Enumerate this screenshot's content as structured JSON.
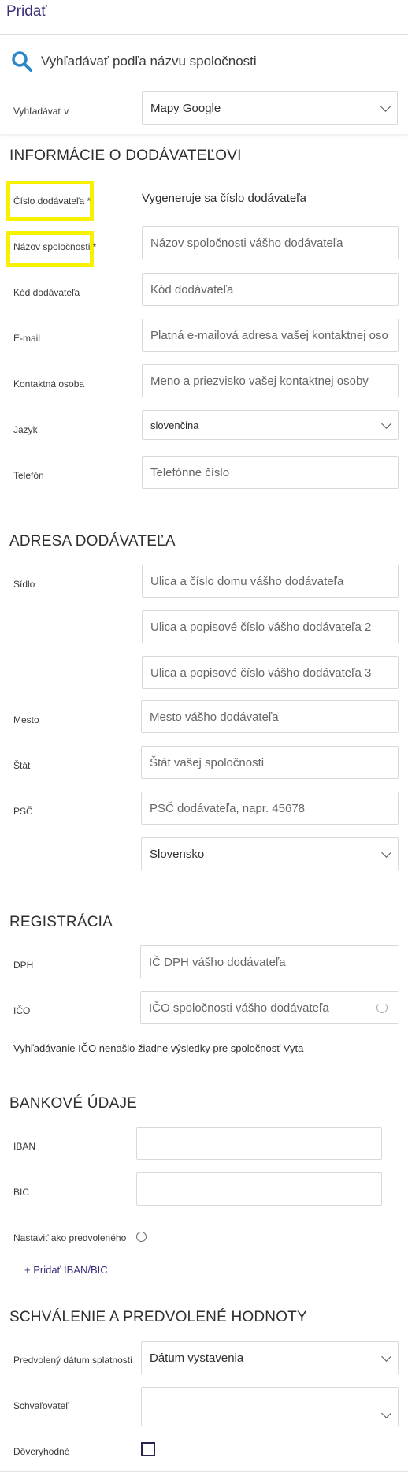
{
  "header": {
    "title": "Pridať"
  },
  "search": {
    "title": "Vyhľadávať podľa názvu spoločnosti",
    "in_label": "Vyhľadávať v",
    "in_value": "Mapy Google"
  },
  "supplier_info": {
    "heading": "INFORMÁCIE O DODÁVATEĽOVI",
    "number_label": "Číslo dodávateľa *",
    "number_value": "Vygeneruje sa číslo dodávateľa",
    "name_label": "Názov spoločnosti *",
    "name_placeholder": "Názov spoločnosti vášho dodávateľa",
    "code_label": "Kód dodávateľa",
    "code_placeholder": "Kód dodávateľa",
    "email_label": "E-mail",
    "email_placeholder": "Platná e-mailová adresa vašej kontaktnej oso",
    "contact_label": "Kontaktná osoba",
    "contact_placeholder": "Meno a priezvisko vašej kontaktnej osoby",
    "language_label": "Jazyk",
    "language_value": "slovenčina",
    "phone_label": "Telefón",
    "phone_placeholder": "Telefónne číslo"
  },
  "address": {
    "heading": "ADRESA DODÁVATEĽA",
    "seat_label": "Sídlo",
    "street1_placeholder": "Ulica a číslo domu vášho dodávateľa",
    "street2_placeholder": "Ulica a popisové číslo vášho dodávateľa 2",
    "street3_placeholder": "Ulica a popisové číslo vášho dodávateľa 3",
    "city_label": "Mesto",
    "city_placeholder": "Mesto vášho dodávateľa",
    "state_label": "Štát",
    "state_placeholder": "Štát vašej spoločnosti",
    "zip_label": "PSČ",
    "zip_placeholder": "PSČ dodávateľa, napr. 45678",
    "country_value": "Slovensko"
  },
  "registration": {
    "heading": "REGISTRÁCIA",
    "vat_label": "DPH",
    "vat_placeholder": "IČ DPH vášho dodávateľa",
    "ico_label": "IČO",
    "ico_placeholder": "IČO spoločnosti vášho dodávateľa",
    "note": "Vyhľadávanie IČO nenašlo žiadne výsledky pre spoločnosť Vyta"
  },
  "bank": {
    "heading": "BANKOVÉ ÚDAJE",
    "iban_label": "IBAN",
    "bic_label": "BIC",
    "default_label": "Nastaviť ako predvoleného",
    "add_link": "+ Pridať IBAN/BIC"
  },
  "approval": {
    "heading": "SCHVÁLENIE A PREDVOLENÉ HODNOTY",
    "due_label": "Predvolený dátum splatnosti",
    "due_value": "Dátum vystavenia",
    "approver_label": "Schvaľovateľ",
    "trusted_label": "Dôveryhodné"
  }
}
